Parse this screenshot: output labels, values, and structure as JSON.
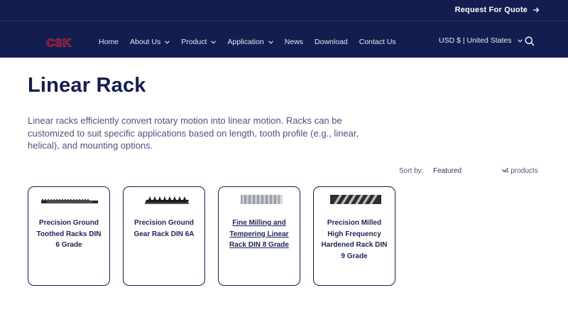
{
  "topbar": {
    "quote_label": "Request For Quote"
  },
  "brand": {
    "logo_text": "CSK",
    "logo_color": "#d9233a",
    "nav_bg": "#131d4f"
  },
  "nav": {
    "items": [
      {
        "label": "Home",
        "dropdown": false
      },
      {
        "label": "About Us",
        "dropdown": true
      },
      {
        "label": "Product",
        "dropdown": true
      },
      {
        "label": "Application",
        "dropdown": true
      },
      {
        "label": "News",
        "dropdown": false
      },
      {
        "label": "Download",
        "dropdown": false
      },
      {
        "label": "Contact Us",
        "dropdown": false
      }
    ],
    "currency": "USD $ | United States"
  },
  "collection": {
    "title": "Linear Rack",
    "description": "Linear racks efficiently convert rotary motion into linear motion. Racks can be customized to suit specific applications based on length, tooth profile (e.g., linear, helical), and mounting options.",
    "sort_label": "Sort by:",
    "sort_value": "Featured",
    "count": "4 products"
  },
  "products": [
    {
      "title": "Precision Ground Toothed Racks DIN 6 Grade",
      "image": "thin-rack"
    },
    {
      "title": "Precision Ground Gear Rack DIN 6A",
      "image": "dark-rack"
    },
    {
      "title": "Fine Milling and Tempering Linear Rack DIN 8 Grade",
      "image": "gray-rack"
    },
    {
      "title": "Precision Milled High Frequency Hardened Rack DIN 9 Grade",
      "image": "helical-rack"
    }
  ]
}
